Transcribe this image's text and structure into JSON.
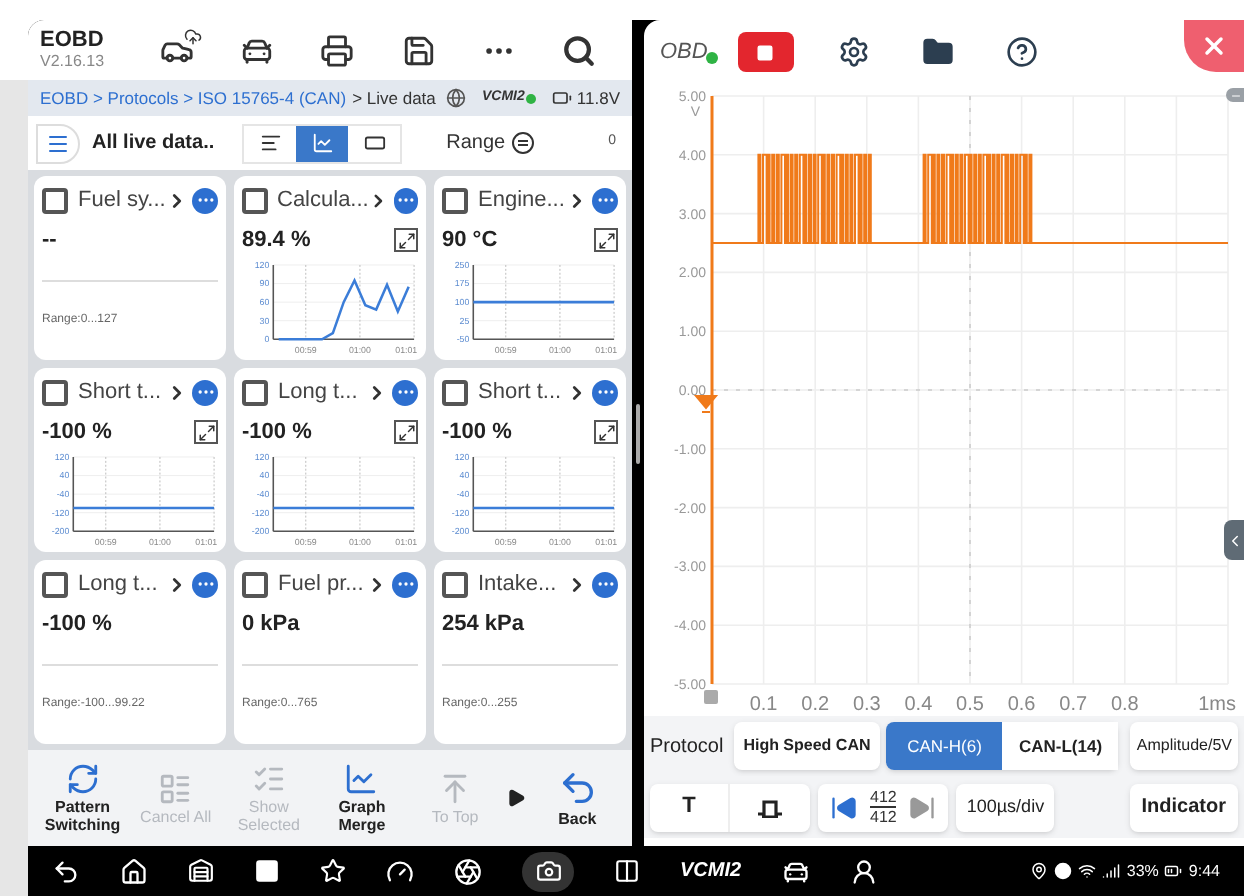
{
  "header": {
    "title": "EOBD",
    "version": "V2.16.13"
  },
  "breadcrumb": {
    "path": "EOBD > Protocols > ISO 15765-4 (CAN)",
    "current": "> Live data",
    "adapter": "VCMI2",
    "voltage": "11.8V"
  },
  "toolbar": {
    "title": "All live data..",
    "range": "Range",
    "count": "0",
    "views": [
      {
        "kind": "text",
        "selected": false
      },
      {
        "kind": "graph",
        "selected": true
      },
      {
        "kind": "gauge",
        "selected": false
      }
    ]
  },
  "cards": [
    {
      "name": "Fuel sy...",
      "value": "--",
      "checked": false,
      "kind": "range",
      "range": "Range:0...127"
    },
    {
      "name": "Calcula...",
      "value": "89.4 %",
      "checked": false,
      "kind": "graph",
      "chart_data": {
        "type": "line",
        "x": [
          58.5,
          58.7,
          58.9,
          59.1,
          59.3,
          59.5,
          59.7,
          59.9,
          60.1,
          60.3,
          60.5,
          60.7,
          60.9
        ],
        "series": [
          {
            "color": "#3b7dd8",
            "values": [
              0,
              0,
              0,
              0,
              0,
              10,
              60,
              95,
              55,
              48,
              88,
              45,
              85
            ]
          }
        ],
        "grid": true,
        "xlim": [
          58.4,
          61
        ],
        "ylim": [
          0,
          120
        ],
        "yticks": [
          0,
          30,
          60,
          90,
          120
        ],
        "xticks": [
          {
            "value": 59,
            "label": "00:59"
          },
          {
            "value": 60,
            "label": "01:00"
          },
          {
            "value": 61,
            "label": "01:01"
          }
        ]
      }
    },
    {
      "name": "Engine...",
      "value": "90 °C",
      "checked": false,
      "kind": "graph",
      "chart_data": {
        "type": "line",
        "x": [
          58.4,
          61
        ],
        "series": [
          {
            "color": "#3b7dd8",
            "values": [
              100,
              100
            ]
          }
        ],
        "grid": true,
        "xlim": [
          58.4,
          61
        ],
        "ylim": [
          -50,
          250
        ],
        "yticks": [
          -50,
          25,
          100,
          175,
          250
        ],
        "xticks": [
          {
            "value": 59,
            "label": "00:59"
          },
          {
            "value": 60,
            "label": "01:00"
          },
          {
            "value": 61,
            "label": "01:01"
          }
        ]
      }
    },
    {
      "name": "Short t...",
      "value": "-100 %",
      "checked": false,
      "kind": "graph",
      "chart_data": {
        "type": "line",
        "x": [
          58.4,
          61
        ],
        "series": [
          {
            "color": "#3b7dd8",
            "values": [
              -100,
              -100
            ]
          }
        ],
        "grid": true,
        "xlim": [
          58.4,
          61
        ],
        "ylim": [
          -200,
          120
        ],
        "yticks": [
          -200,
          -120,
          -40,
          40,
          120
        ],
        "xticks": [
          {
            "value": 59,
            "label": "00:59"
          },
          {
            "value": 60,
            "label": "01:00"
          },
          {
            "value": 61,
            "label": "01:01"
          }
        ]
      }
    },
    {
      "name": "Long t...",
      "value": "-100 %",
      "checked": false,
      "kind": "graph",
      "chart_data": {
        "type": "line",
        "x": [
          58.4,
          61
        ],
        "series": [
          {
            "color": "#3b7dd8",
            "values": [
              -100,
              -100
            ]
          }
        ],
        "grid": true,
        "xlim": [
          58.4,
          61
        ],
        "ylim": [
          -200,
          120
        ],
        "yticks": [
          -200,
          -120,
          -40,
          40,
          120
        ],
        "xticks": [
          {
            "value": 59,
            "label": "00:59"
          },
          {
            "value": 60,
            "label": "01:00"
          },
          {
            "value": 61,
            "label": "01:01"
          }
        ]
      }
    },
    {
      "name": "Short t...",
      "value": "-100 %",
      "checked": false,
      "kind": "graph",
      "chart_data": {
        "type": "line",
        "x": [
          58.4,
          61
        ],
        "series": [
          {
            "color": "#3b7dd8",
            "values": [
              -100,
              -100
            ]
          }
        ],
        "grid": true,
        "xlim": [
          58.4,
          61
        ],
        "ylim": [
          -200,
          120
        ],
        "yticks": [
          -200,
          -120,
          -40,
          40,
          120
        ],
        "xticks": [
          {
            "value": 59,
            "label": "00:59"
          },
          {
            "value": 60,
            "label": "01:00"
          },
          {
            "value": 61,
            "label": "01:01"
          }
        ]
      }
    },
    {
      "name": "Long t...",
      "value": "-100 %",
      "checked": false,
      "kind": "range",
      "range": "Range:-100...99.22"
    },
    {
      "name": "Fuel pr...",
      "value": "0 kPa",
      "checked": false,
      "kind": "range",
      "range": "Range:0...765"
    },
    {
      "name": "Intake...",
      "value": "254 kPa",
      "checked": false,
      "kind": "range",
      "range": "Range:0...255"
    }
  ],
  "actions": [
    {
      "kind": "pattern",
      "label": "Pattern Switching",
      "disabled": false
    },
    {
      "kind": "cancel",
      "label": "Cancel All",
      "disabled": true
    },
    {
      "kind": "show",
      "label": "Show Selected",
      "disabled": true
    },
    {
      "kind": "merge",
      "label": "Graph Merge",
      "disabled": false
    },
    {
      "kind": "top",
      "label": "To Top",
      "disabled": true
    },
    {
      "kind": "back",
      "label": "Back",
      "disabled": false
    }
  ],
  "scope": {
    "source": "OBD",
    "unit": "V",
    "y_labels": [
      "5.00",
      "4.00",
      "3.00",
      "2.00",
      "1.00",
      "0.00",
      "-1.00",
      "-2.00",
      "-3.00",
      "-4.00",
      "-5.00"
    ],
    "x_labels": [
      "0.1",
      "0.2",
      "0.3",
      "0.4",
      "0.5",
      "0.6",
      "0.7",
      "0.8"
    ],
    "x_end": "1ms"
  },
  "protocol": {
    "label": "Protocol",
    "name": "High Speed CAN",
    "channels": [
      {
        "label": "CAN-H(6)",
        "selected": true
      },
      {
        "label": "CAN-L(14)",
        "selected": false
      }
    ],
    "amplitude": "Amplitude/5V"
  },
  "controls": {
    "trigger": "T",
    "frame": "412",
    "total": "412",
    "timebase": "100µs/div",
    "indicator": "Indicator"
  },
  "status_bar": {
    "adapter": "VCMI2",
    "battery": "33%",
    "time": "9:44"
  }
}
